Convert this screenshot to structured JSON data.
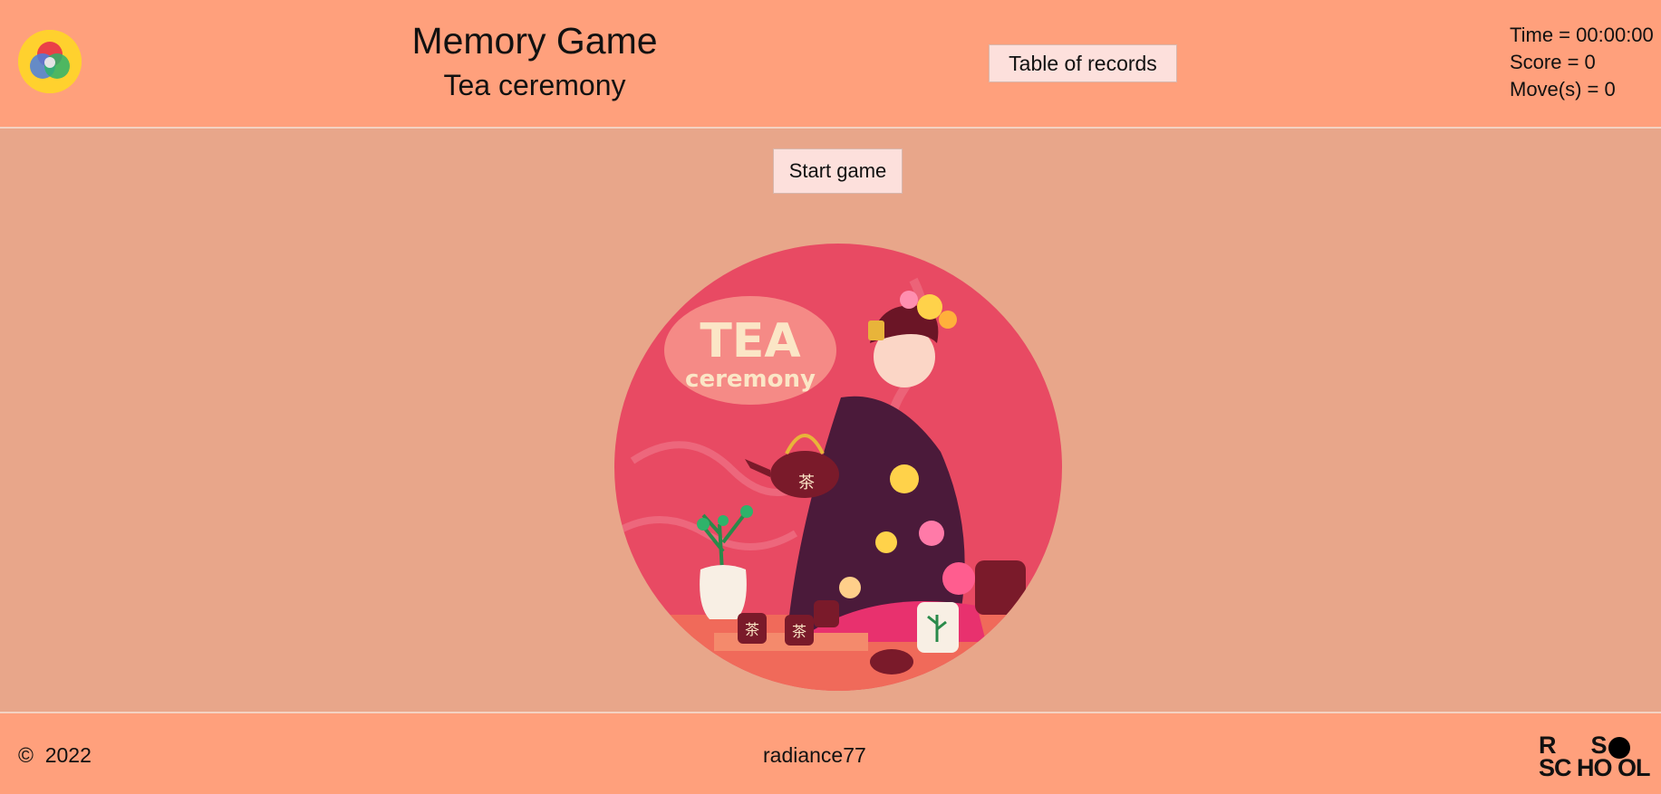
{
  "header": {
    "title": "Memory Game",
    "subtitle": "Tea ceremony",
    "records_button": "Table of records",
    "time": "Time = 00:00:00",
    "score": "Score = 0",
    "moves": "Move(s) = 0"
  },
  "main": {
    "start_button": "Start game",
    "hero": {
      "line1": "TEA",
      "line2": "ceremony",
      "kanji": "茶"
    }
  },
  "footer": {
    "copyright": "©  2022",
    "author": "radiance77",
    "rs_logo_line1": "R      S",
    "rs_logo_line2": "SC HO OL"
  },
  "colors": {
    "header_bg": "#ffa07c",
    "page_bg": "#e8a68a",
    "button_bg": "#fde0dc",
    "hero_bg": "#e84a63"
  },
  "icons": {
    "app_logo": "color-circles-logo-icon",
    "footer_logo": "rs-school-logo-icon"
  }
}
